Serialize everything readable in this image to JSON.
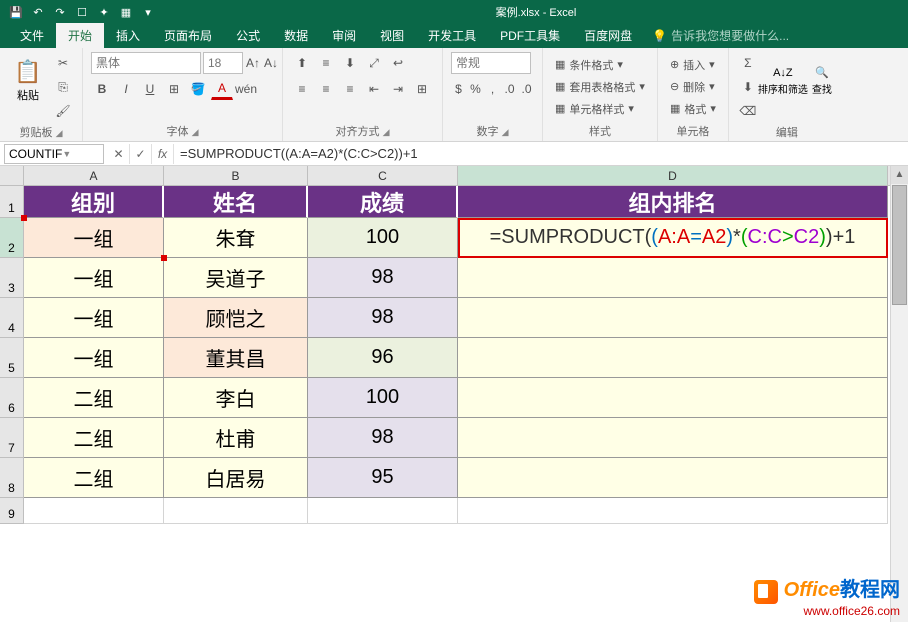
{
  "app": {
    "title": "案例.xlsx - Excel"
  },
  "qat": [
    "save",
    "undo",
    "redo",
    "touch-mode",
    "new",
    "quick-print",
    "customize"
  ],
  "tabs": {
    "file": "文件",
    "items": [
      "开始",
      "插入",
      "页面布局",
      "公式",
      "数据",
      "审阅",
      "视图",
      "开发工具",
      "PDF工具集",
      "百度网盘"
    ],
    "active": "开始",
    "tell_me_icon": "💡",
    "tell_me": "告诉我您想要做什么..."
  },
  "ribbon": {
    "clipboard": {
      "label": "剪贴板",
      "paste": "粘贴"
    },
    "font": {
      "label": "字体",
      "family_placeholder": "黑体",
      "size_placeholder": "18",
      "bold": "B",
      "italic": "I",
      "underline": "U"
    },
    "alignment": {
      "label": "对齐方式"
    },
    "number": {
      "label": "数字",
      "format_placeholder": "常规"
    },
    "styles": {
      "label": "样式",
      "conditional": "条件格式",
      "table": "套用表格格式",
      "cell": "单元格样式"
    },
    "cells": {
      "label": "单元格",
      "insert": "插入",
      "delete": "删除",
      "format": "格式"
    },
    "editing": {
      "label": "编辑",
      "sort": "排序和筛选",
      "find": "查找"
    }
  },
  "formula_bar": {
    "name": "COUNTIF",
    "formula": "=SUMPRODUCT((A:A=A2)*(C:C>C2))+1"
  },
  "columns": [
    "A",
    "B",
    "C",
    "D"
  ],
  "headers": {
    "A": "组别",
    "B": "姓名",
    "C": "成绩",
    "D": "组内排名"
  },
  "formula_parts": {
    "prefix": "=SUMPRODUCT",
    "p_open": "(",
    "p1_open": "(",
    "ref1": "A:A",
    "eq": "=",
    "ref2": "A2",
    "p1_close": ")",
    "mul": "*",
    "p2_open": "(",
    "ref3": "C:C",
    "gt": ">",
    "ref4": "C2",
    "p2_close": ")",
    "p_close": ")",
    "suffix": "+1"
  },
  "rows": [
    {
      "n": "2",
      "A": "一组",
      "B": "朱耷",
      "C": "100",
      "cls": {
        "A": "c-sal",
        "B": "c-yel",
        "C": "c-grn",
        "D": "c-yel"
      }
    },
    {
      "n": "3",
      "A": "一组",
      "B": "吴道子",
      "C": "98",
      "cls": {
        "A": "c-yel",
        "B": "c-yel",
        "C": "c-lav",
        "D": "c-yel"
      }
    },
    {
      "n": "4",
      "A": "一组",
      "B": "顾恺之",
      "C": "98",
      "cls": {
        "A": "c-yel",
        "B": "c-sal",
        "C": "c-lav",
        "D": "c-yel"
      }
    },
    {
      "n": "5",
      "A": "一组",
      "B": "董其昌",
      "C": "96",
      "cls": {
        "A": "c-yel",
        "B": "c-sal",
        "C": "c-grn",
        "D": "c-yel"
      }
    },
    {
      "n": "6",
      "A": "二组",
      "B": "李白",
      "C": "100",
      "cls": {
        "A": "c-yel",
        "B": "c-yel",
        "C": "c-lav",
        "D": "c-yel"
      }
    },
    {
      "n": "7",
      "A": "二组",
      "B": "杜甫",
      "C": "98",
      "cls": {
        "A": "c-yel",
        "B": "c-yel",
        "C": "c-lav",
        "D": "c-yel"
      }
    },
    {
      "n": "8",
      "A": "二组",
      "B": "白居易",
      "C": "95",
      "cls": {
        "A": "c-yel",
        "B": "c-yel",
        "C": "c-lav",
        "D": "c-yel"
      }
    }
  ],
  "watermark": {
    "t1": "Office",
    "t2": "教程网",
    "url": "www.office26.com"
  }
}
